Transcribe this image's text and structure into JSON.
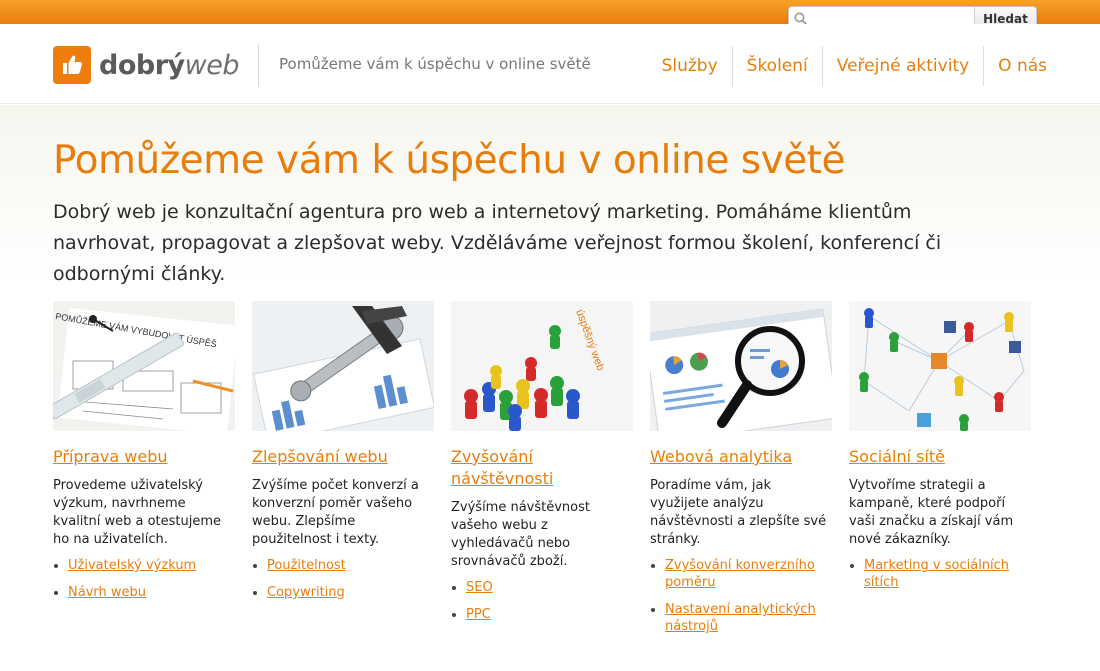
{
  "search": {
    "placeholder": "",
    "value": "",
    "button_label": "Hledat"
  },
  "logo": {
    "brand_part1": "dobrý",
    "brand_part2": "web"
  },
  "header": {
    "tagline": "Pomůžeme vám k úspěchu v online světě"
  },
  "nav": {
    "items": [
      {
        "label": "Služby"
      },
      {
        "label": "Školení"
      },
      {
        "label": "Veřejné aktivity"
      },
      {
        "label": "O nás"
      }
    ]
  },
  "hero": {
    "title": "Pomůžeme vám k úspěchu v online světě",
    "lead": "Dobrý web je konzultační agentura pro web a internetový marketing. Pomáháme klientům navrhovat, propagovat a zlepšovat weby. Vzděláváme veřejnost formou školení, konferencí či odbornými články."
  },
  "cards": [
    {
      "title": "Příprava webu",
      "text": "Provedeme uživatelský výzkum, navrhneme kvalitní web a otestujeme ho na uživatelích.",
      "links": [
        "Uživatelský výzkum",
        "Návrh webu"
      ]
    },
    {
      "title": "Zlepšování webu",
      "text": "Zvýšíme počet konverzí a konverzní poměr vašeho webu. Zlepšíme použitelnost i texty.",
      "links": [
        "Použitelnost",
        "Copywriting"
      ]
    },
    {
      "title": "Zvyšování návštěvnosti",
      "text": "Zvýšíme návštěvnost vašeho webu z vyhledávačů nebo srovnávačů zboží.",
      "links": [
        "SEO",
        "PPC"
      ]
    },
    {
      "title": "Webová analytika",
      "text": "Poradíme vám, jak využijete analýzu návštěvnosti a zlepšíte své stránky.",
      "links": [
        "Zvyšování konverzního poměru",
        "Nastavení analytických nástrojů"
      ]
    },
    {
      "title": "Sociální sítě",
      "text": "Vytvoříme strategii a kampaně, které podpoří vaši značku a získají vám nové zákazníky.",
      "links": [
        "Marketing v sociálních sítích"
      ]
    }
  ],
  "card_images": [
    {
      "caption": "POMŮŽEME VÁM VYBUDOVAT ÚSPĚŠ"
    },
    {
      "caption": ""
    },
    {
      "caption": "úspěšný web"
    },
    {
      "caption": ""
    },
    {
      "caption": ""
    }
  ],
  "colors": {
    "accent": "#e67e0e",
    "topbar": "#f08a16",
    "text": "#222222"
  }
}
